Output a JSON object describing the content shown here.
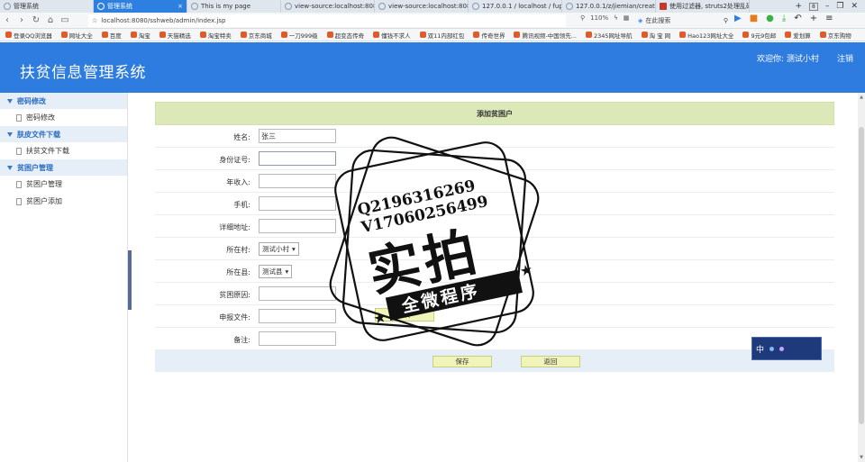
{
  "browser": {
    "tabs": [
      {
        "label": "管理系统",
        "active": false
      },
      {
        "label": "管理系统",
        "active": true
      },
      {
        "label": "This is my page",
        "active": false
      },
      {
        "label": "view-source:localhost:8080/",
        "active": false
      },
      {
        "label": "view-source:localhost:8080/",
        "active": false
      },
      {
        "label": "127.0.0.1 / localhost / fupin",
        "active": false
      },
      {
        "label": "127.0.0.1/z/jiemian/create.p",
        "active": false
      },
      {
        "label": "使用过滤器, struts2处理乱码",
        "active": false
      }
    ],
    "tab_count": "8",
    "url": "localhost:8080/sshweb/admin/index.jsp",
    "zoom": "110%",
    "search_placeholder": "在此搜索",
    "bookmarks": [
      "登录QQ浏览器",
      "网址大全",
      "百度",
      "淘宝",
      "天猫精选",
      "淘宝特卖",
      "京东商城",
      "一刀999级",
      "超变态传奇",
      "懂钱不求人",
      "双11内部红包",
      "传奇世界",
      "腾讯视频-中国领先...",
      "2345网址导航",
      "淘 宝 网",
      "Hao123网址大全",
      "9元9包邮",
      "爱划算",
      "京东购物"
    ]
  },
  "header": {
    "title": "扶贫信息管理系统",
    "welcome": "欢迎你: 测试小村",
    "logout": "注销"
  },
  "sidebar": {
    "groups": [
      {
        "title": "密码修改",
        "items": [
          "密码修改"
        ]
      },
      {
        "title": "肤皮文件下载",
        "items": [
          "扶贫文件下载"
        ]
      },
      {
        "title": "贫困户管理",
        "items": [
          "贫困户管理",
          "贫困户添加"
        ]
      }
    ]
  },
  "form": {
    "title": "添加贫困户",
    "fields": {
      "name": {
        "label": "姓名:",
        "value": "张三"
      },
      "id_number": {
        "label": "身份证号:",
        "value": ""
      },
      "income": {
        "label": "年收入:",
        "value": ""
      },
      "phone": {
        "label": "手机:",
        "value": ""
      },
      "address": {
        "label": "详细地址:",
        "value": ""
      },
      "village": {
        "label": "所在村:",
        "value": "测试小村"
      },
      "county": {
        "label": "所在县:",
        "value": "测试县"
      },
      "reason": {
        "label": "贫困原因:",
        "value": ""
      },
      "file": {
        "label": "申报文件:",
        "value": "",
        "upload_label": "上传"
      },
      "note": {
        "label": "备注:",
        "value": ""
      }
    },
    "save_label": "保存",
    "back_label": "返回"
  },
  "watermark": {
    "line1": "Q2196316269",
    "line2": "V17060256499",
    "big": "实拍",
    "banner": "全微程序"
  },
  "ime": {
    "label": "中"
  },
  "colors": {
    "header": "#2f7ce0",
    "form_title": "#dce8b8",
    "button": "#f0f4b8"
  }
}
